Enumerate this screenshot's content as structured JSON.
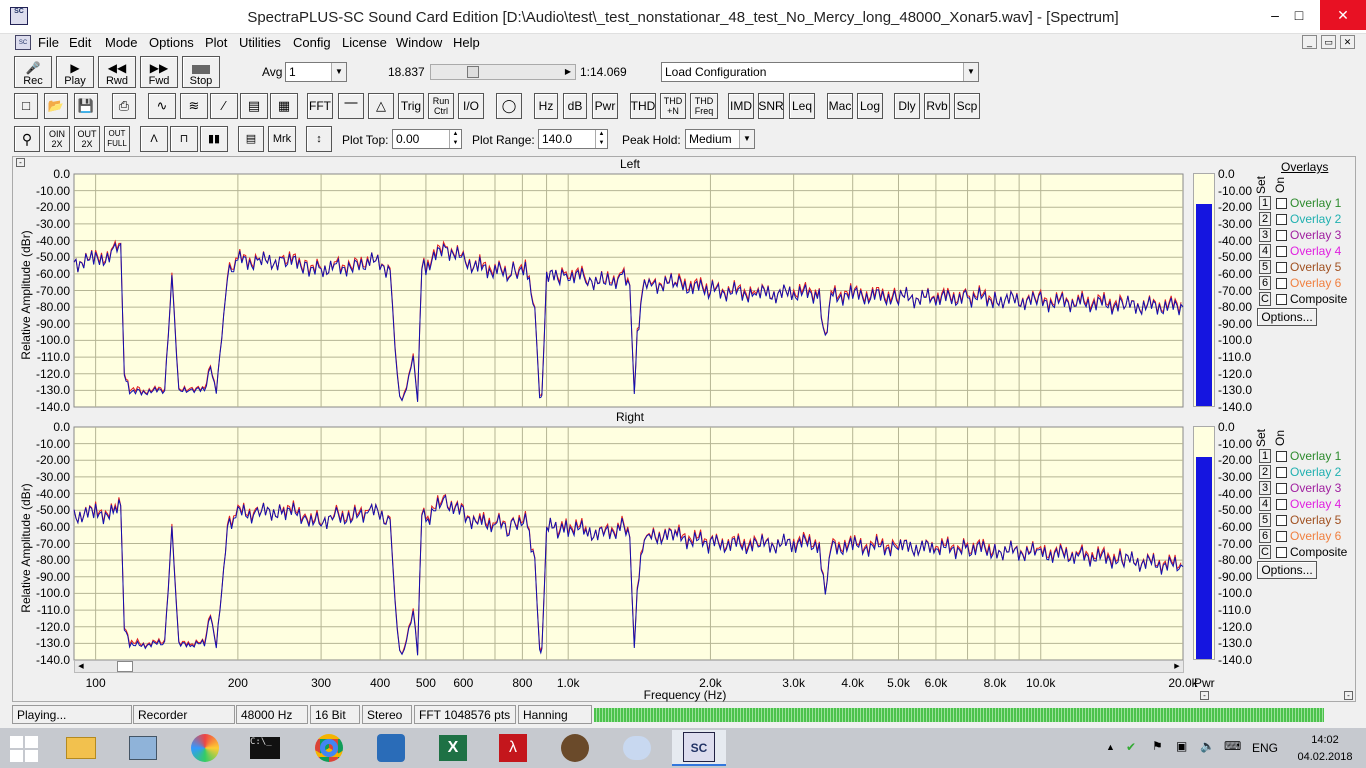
{
  "window": {
    "title": "SpectraPLUS-SC Sound Card Edition [D:\\Audio\\test\\_test_nonstationar_48_test_No_Mercy_long_48000_Xonar5.wav] - [Spectrum]"
  },
  "menu": [
    "File",
    "Edit",
    "Mode",
    "Options",
    "Plot",
    "Utilities",
    "Config",
    "License",
    "Window",
    "Help"
  ],
  "transport": {
    "rec": "Rec",
    "play": "Play",
    "rwd": "Rwd",
    "fwd": "Fwd",
    "stop": "Stop",
    "avg_label": "Avg",
    "avg_value": "1",
    "pos_start": "18.837",
    "pos_end": "1:14.069",
    "config": "Load Configuration"
  },
  "toolbar2": [
    "FFT",
    "Trig",
    "Run Ctrl",
    "I/O",
    "Hz",
    "dB",
    "Pwr",
    "THD",
    "THD +N",
    "THD Freq",
    "IMD",
    "SNR",
    "Leq",
    "Mac",
    "Log",
    "Dly",
    "Rvb",
    "Scp"
  ],
  "toolbar3": {
    "zin": "OIN 2X",
    "zout": "OUT 2X",
    "zfull": "OUT FULL",
    "mrk": "Mrk",
    "plot_top_label": "Plot Top:",
    "plot_top": "0.00",
    "plot_range_label": "Plot Range:",
    "plot_range": "140.0",
    "peak_hold_label": "Peak Hold:",
    "peak_hold": "Medium"
  },
  "plots": [
    {
      "title": "Left"
    },
    {
      "title": "Right"
    }
  ],
  "yticks": [
    "0.0",
    "-10.00",
    "-20.00",
    "-30.00",
    "-40.00",
    "-50.00",
    "-60.00",
    "-70.00",
    "-80.00",
    "-90.00",
    "-100.0",
    "-110.0",
    "-120.0",
    "-130.0",
    "-140.0"
  ],
  "meter_ticks": [
    "0.0",
    "-10.00",
    "-20.00",
    "-30.00",
    "-40.00",
    "-50.00",
    "-60.00",
    "-70.00",
    "-80.00",
    "-90.00",
    "-100.0",
    "-110.0",
    "-120.0",
    "-130.0",
    "-140.0"
  ],
  "ylabel": "Relative Amplitude (dBr)",
  "xlabel": "Frequency (Hz)",
  "xticks": [
    "100",
    "200",
    "300",
    "400",
    "500",
    "600",
    "800",
    "1.0k",
    "2.0k",
    "3.0k",
    "4.0k",
    "5.0k",
    "6.0k",
    "8.0k",
    "10.0k",
    "20.0k"
  ],
  "pwr": "Pwr",
  "overlays": {
    "title": "Overlays",
    "set": "Set",
    "on": "On",
    "items": [
      {
        "n": "1",
        "label": "Overlay 1",
        "color": "#2e8b2e"
      },
      {
        "n": "2",
        "label": "Overlay 2",
        "color": "#20b0b0"
      },
      {
        "n": "3",
        "label": "Overlay 3",
        "color": "#a020a0"
      },
      {
        "n": "4",
        "label": "Overlay 4",
        "color": "#e020e0"
      },
      {
        "n": "5",
        "label": "Overlay 5",
        "color": "#a05020"
      },
      {
        "n": "6",
        "label": "Overlay 6",
        "color": "#f08040"
      },
      {
        "n": "C",
        "label": "Composite",
        "color": "#000000"
      }
    ],
    "options": "Options..."
  },
  "status": [
    "Playing...",
    "Recorder",
    "48000 Hz",
    "16 Bit",
    "Stereo",
    "FFT 1048576 pts",
    "Hanning"
  ],
  "tray": {
    "lang": "ENG",
    "time": "14:02",
    "date": "04.02.2018"
  },
  "chart_data": [
    {
      "type": "line",
      "title": "Left",
      "xlabel": "Frequency (Hz)",
      "ylabel": "Relative Amplitude (dBr)",
      "xscale": "log",
      "xlim": [
        90,
        20000
      ],
      "ylim": [
        -140,
        0
      ],
      "series": [
        {
          "x": [
            90,
            100,
            110,
            113,
            115,
            118,
            125,
            140,
            145,
            150,
            160,
            170,
            175,
            180,
            190,
            200,
            220,
            250,
            280,
            300,
            320,
            350,
            380,
            420,
            430,
            440,
            450,
            470,
            480,
            490,
            500,
            550,
            600,
            650,
            700,
            750,
            780,
            820,
            850,
            870,
            880,
            900,
            950,
            1000,
            1100,
            1200,
            1300,
            1350,
            1380,
            1400,
            1450,
            1500,
            1700,
            2000,
            2500,
            3000,
            3400,
            3500,
            3600,
            4000,
            5000,
            6000,
            7000,
            8000,
            10000,
            12000,
            15000,
            20000
          ],
          "y": [
            -53,
            -52,
            -48,
            -43,
            -120,
            -130,
            -131,
            -130,
            -62,
            -131,
            -130,
            -130,
            -115,
            -131,
            -62,
            -52,
            -53,
            -52,
            -55,
            -58,
            -54,
            -57,
            -52,
            -57,
            -105,
            -135,
            -134,
            -110,
            -136,
            -52,
            -56,
            -44,
            -52,
            -56,
            -58,
            -60,
            -57,
            -58,
            -80,
            -136,
            -135,
            -62,
            -62,
            -60,
            -63,
            -65,
            -62,
            -68,
            -133,
            -95,
            -63,
            -66,
            -66,
            -70,
            -72,
            -72,
            -72,
            -100,
            -73,
            -73,
            -74,
            -75,
            -74,
            -75,
            -77,
            -77,
            -79,
            -80
          ]
        }
      ]
    },
    {
      "type": "line",
      "title": "Right",
      "xlabel": "Frequency (Hz)",
      "ylabel": "Relative Amplitude (dBr)",
      "xscale": "log",
      "xlim": [
        90,
        20000
      ],
      "ylim": [
        -140,
        0
      ],
      "series": [
        {
          "x": [
            90,
            100,
            110,
            113,
            115,
            118,
            125,
            140,
            145,
            150,
            160,
            170,
            175,
            180,
            190,
            200,
            220,
            250,
            280,
            300,
            320,
            350,
            380,
            420,
            430,
            440,
            450,
            470,
            480,
            490,
            500,
            550,
            600,
            650,
            700,
            750,
            780,
            820,
            850,
            870,
            880,
            900,
            950,
            1000,
            1100,
            1200,
            1300,
            1350,
            1380,
            1400,
            1450,
            1500,
            1700,
            2000,
            2500,
            3000,
            3400,
            3500,
            3600,
            4000,
            5000,
            6000,
            7000,
            8000,
            10000,
            12000,
            15000,
            20000
          ],
          "y": [
            -53,
            -52,
            -52,
            -47,
            -120,
            -130,
            -131,
            -130,
            -62,
            -131,
            -131,
            -130,
            -112,
            -132,
            -62,
            -52,
            -52,
            -50,
            -54,
            -57,
            -52,
            -55,
            -50,
            -56,
            -105,
            -135,
            -134,
            -110,
            -136,
            -50,
            -56,
            -44,
            -53,
            -57,
            -58,
            -60,
            -56,
            -58,
            -80,
            -136,
            -135,
            -60,
            -62,
            -60,
            -63,
            -64,
            -60,
            -68,
            -133,
            -95,
            -64,
            -65,
            -66,
            -70,
            -71,
            -70,
            -70,
            -100,
            -72,
            -72,
            -72,
            -73,
            -73,
            -74,
            -76,
            -77,
            -80,
            -84
          ]
        }
      ]
    }
  ]
}
